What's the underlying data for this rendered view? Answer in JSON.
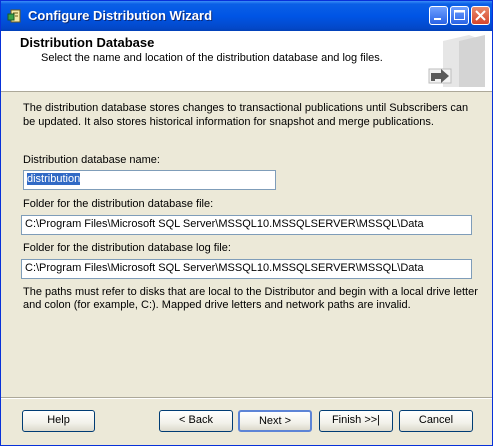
{
  "window": {
    "title": "Configure Distribution Wizard",
    "icon": "wizard-app-icon",
    "controls": [
      "minimize-icon",
      "maximize-icon",
      "close-icon"
    ]
  },
  "header": {
    "title": "Distribution Database",
    "subtitle": "Select the name and location of the distribution database and log files."
  },
  "main": {
    "intro": "The distribution database stores changes to transactional publications until Subscribers can be updated. It also stores historical information for snapshot and merge publications.",
    "db_name_label": "Distribution database name:",
    "db_name_value": "distribution",
    "db_folder_label": "Folder for the distribution database file:",
    "db_folder_value": "C:\\Program Files\\Microsoft SQL Server\\MSSQL10.MSSQLSERVER\\MSSQL\\Data",
    "log_folder_label": "Folder for the distribution database log file:",
    "log_folder_value": "C:\\Program Files\\Microsoft SQL Server\\MSSQL10.MSSQLSERVER\\MSSQL\\Data",
    "note": "The paths must refer to disks that are local to the Distributor and begin with a local drive letter and colon (for example, C:). Mapped drive letters and network paths are invalid."
  },
  "buttons": {
    "help": "Help",
    "back": "< Back",
    "next": "Next >",
    "finish": "Finish >>|",
    "cancel": "Cancel"
  }
}
